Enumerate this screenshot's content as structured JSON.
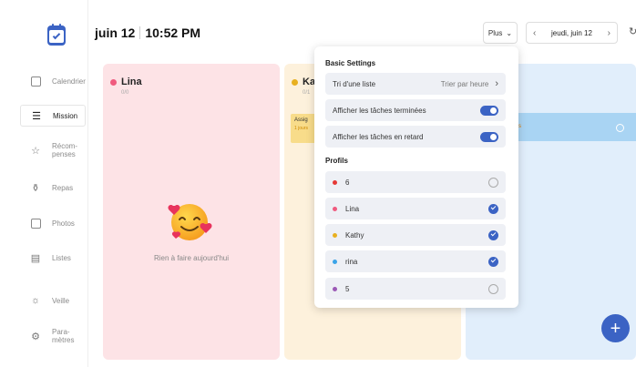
{
  "header": {
    "date": "juin 12",
    "time": "10:52 PM",
    "more_label": "Plus",
    "date_nav_label": "jeudi, juin 12"
  },
  "sidebar": {
    "items": [
      {
        "label": "Calendrier",
        "icon": "calendar-icon",
        "active": false
      },
      {
        "label": "Mission",
        "icon": "mission-icon",
        "active": true
      },
      {
        "label": "Récom-\npenses",
        "icon": "gift-icon",
        "active": false
      },
      {
        "label": "Repas",
        "icon": "meal-icon",
        "active": false
      },
      {
        "label": "Photos",
        "icon": "photo-icon",
        "active": false
      },
      {
        "label": "Listes",
        "icon": "list-icon",
        "active": false
      },
      {
        "label": "Veille",
        "icon": "sun-icon",
        "active": false
      },
      {
        "label": "Para-\nmètres",
        "icon": "settings-icon",
        "active": false
      }
    ]
  },
  "columns": [
    {
      "name": "Lina",
      "count": "0/0",
      "color": "#f05a7e",
      "empty_text": "Rien à faire aujourd'hui"
    },
    {
      "name": "Ka",
      "count": "0/1",
      "color": "#e8b020",
      "task_title": "Assig",
      "task_sub": "1 jours"
    },
    {
      "task_fragment": "s"
    }
  ],
  "popup": {
    "basic_title": "Basic Settings",
    "sort_label": "Tri d'une liste",
    "sort_value": "Trier par heure",
    "show_done_label": "Afficher les tâches terminées",
    "show_late_label": "Afficher les tâches en retard",
    "show_done_enabled": true,
    "show_late_enabled": true,
    "profiles_title": "Profils",
    "profiles": [
      {
        "name": "6",
        "color": "#e53935",
        "selected": false
      },
      {
        "name": "Lina",
        "color": "#f05a7e",
        "selected": true
      },
      {
        "name": "Kathy",
        "color": "#e8b020",
        "selected": true
      },
      {
        "name": "rina",
        "color": "#3ba4e8",
        "selected": true
      },
      {
        "name": "5",
        "color": "#9b59b6",
        "selected": false
      }
    ]
  },
  "colors": {
    "accent": "#3b63c4",
    "lina_bg": "#fde3e6",
    "kathy_bg": "#fdf1dc",
    "rina_bg": "#e1eefb"
  }
}
